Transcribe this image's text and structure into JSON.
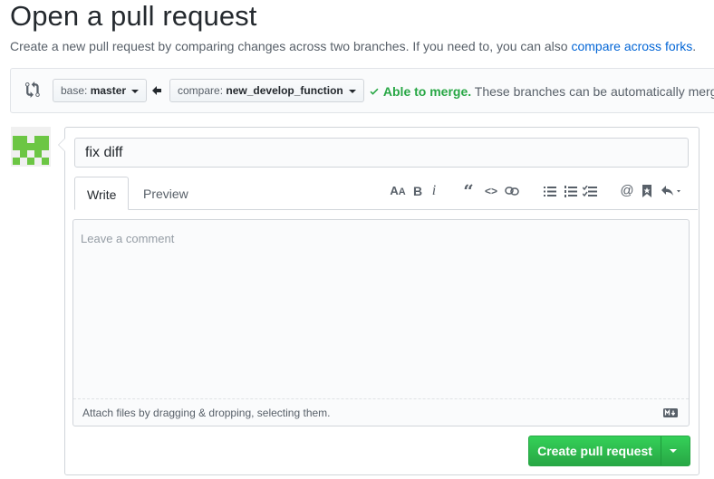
{
  "header": {
    "title": "Open a pull request",
    "subtitle": "Create a new pull request by comparing changes across two branches. If you need to, you can also",
    "subtitle_link": "compare across forks",
    "subtitle_end": "."
  },
  "range": {
    "base_prefix": "base:",
    "base_branch": "master",
    "compare_prefix": "compare:",
    "compare_branch": "new_develop_function",
    "merge_status": "Able to merge.",
    "merge_detail": "These branches can be automatically merged."
  },
  "form": {
    "title_value": "fix diff",
    "tabs": [
      "Write",
      "Preview"
    ],
    "comment_placeholder": "Leave a comment",
    "attach_text": "Attach files by dragging & dropping, selecting them.",
    "submit_label": "Create pull request"
  },
  "toolbar_icons": [
    "header-icon",
    "bold-icon",
    "italic-icon",
    "quote-icon",
    "code-icon",
    "link-icon",
    "bullet-list-icon",
    "numbered-list-icon",
    "task-list-icon",
    "mention-icon",
    "reference-icon",
    "reply-icon"
  ],
  "colors": {
    "accent_green": "#28a745",
    "link_blue": "#0366d6"
  }
}
